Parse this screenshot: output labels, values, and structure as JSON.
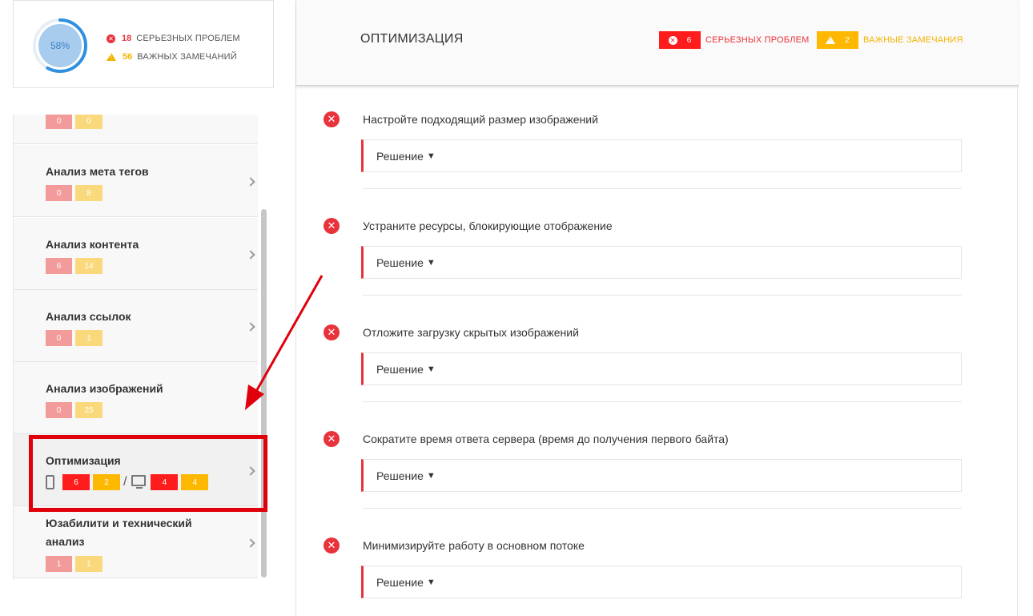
{
  "summary": {
    "score": "58%",
    "serious_count": "18",
    "serious_label": "СЕРЬЕЗНЫХ ПРОБЛЕМ",
    "important_count": "56",
    "important_label": "ВАЖНЫХ ЗАМЕЧАНИЙ",
    "score_fraction": 0.58
  },
  "sidebar": {
    "items": [
      {
        "title": "",
        "errors": "0",
        "warnings": "0"
      },
      {
        "title": "Анализ мета тегов",
        "errors": "0",
        "warnings": "8"
      },
      {
        "title": "Анализ контента",
        "errors": "6",
        "warnings": "14"
      },
      {
        "title": "Анализ ссылок",
        "errors": "0",
        "warnings": "1"
      },
      {
        "title": "Анализ изображений",
        "errors": "0",
        "warnings": "25"
      },
      {
        "title": "Оптимизация",
        "mobile_errors": "6",
        "mobile_warnings": "2",
        "separator": "/",
        "desktop_errors": "4",
        "desktop_warnings": "4"
      },
      {
        "title": "Юзабилити и технический анализ",
        "errors": "1",
        "warnings": "1"
      }
    ]
  },
  "main": {
    "title": "ОПТИМИЗАЦИЯ",
    "serious_count": "6",
    "serious_label": "СЕРЬЕЗНЫХ ПРОБЛЕМ",
    "important_count": "2",
    "important_label": "ВАЖНЫЕ ЗАМЕЧАНИЯ",
    "issues": [
      {
        "text": "Настройте подходящий размер изображений",
        "solution": "Решение"
      },
      {
        "text": "Устраните ресурсы, блокирующие отображение",
        "solution": "Решение"
      },
      {
        "text": "Отложите загрузку скрытых изображений",
        "solution": "Решение"
      },
      {
        "text": "Сократите время ответа сервера (время до получения первого байта)",
        "solution": "Решение"
      },
      {
        "text": "Минимизируйте работу в основном потоке",
        "solution": "Решение"
      }
    ]
  },
  "colors": {
    "error": "#ff1c1c",
    "warning": "#ffb800",
    "error_light": "#f39b9b",
    "warning_light": "#fad97c",
    "highlight": "#e0000b",
    "ring": "#2f8fe0"
  }
}
